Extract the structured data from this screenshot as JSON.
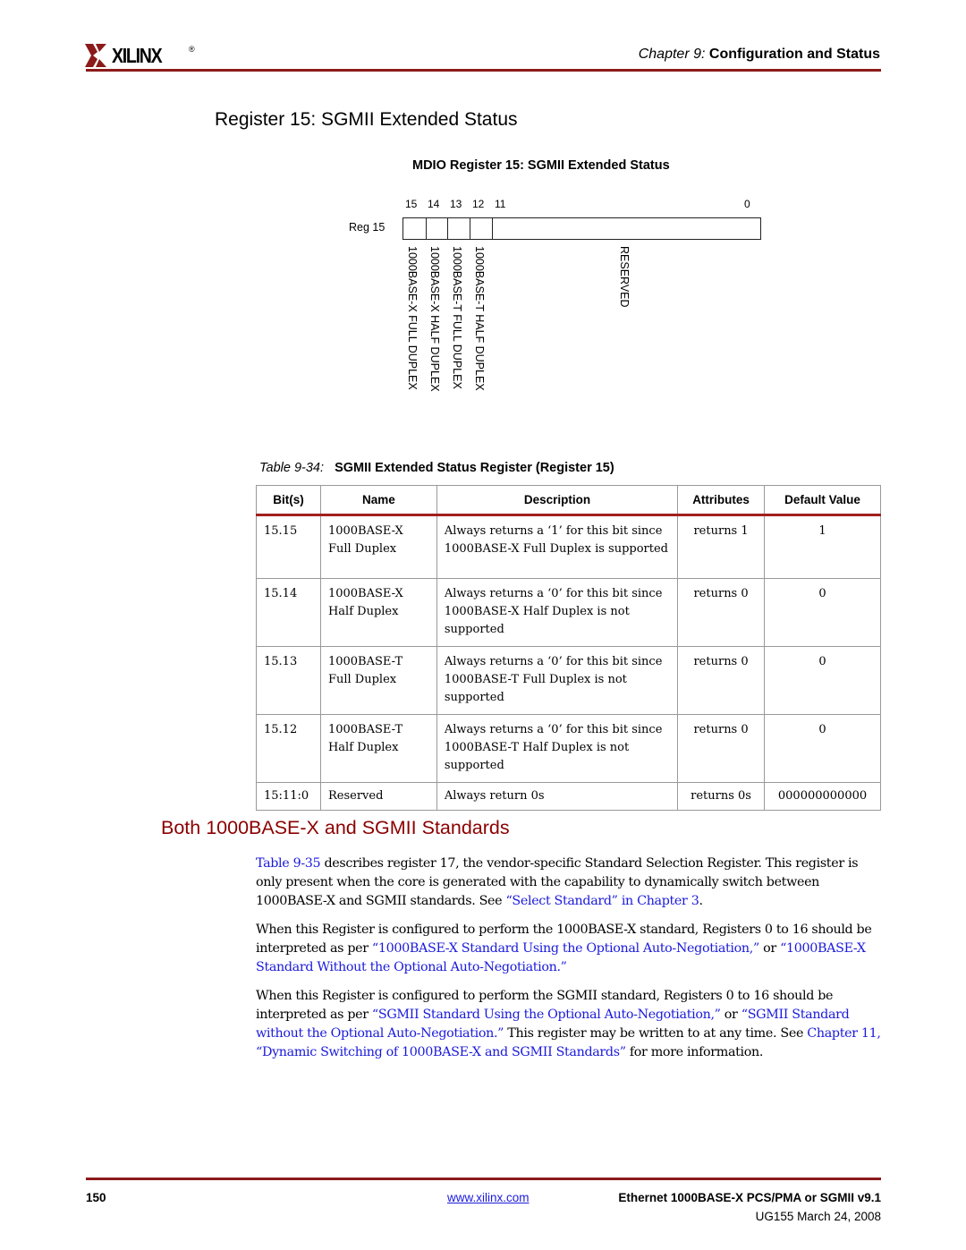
{
  "header": {
    "logo_text": "XILINX",
    "logo_mark": "®",
    "chapter_label": "Chapter 9:",
    "chapter_title": "Configuration and Status"
  },
  "register_section": {
    "heading": "Register 15: SGMII Extended Status",
    "figure_title": "MDIO Register 15: SGMII Extended Status",
    "register_label": "Reg 15",
    "bit_numbers": [
      "15",
      "14",
      "13",
      "12",
      "11",
      "0"
    ],
    "field_labels": [
      "1000BASE-X FULL DUPLEX",
      "1000BASE-X HALF DUPLEX",
      "1000BASE-T FULL DUPLEX",
      "1000BASE-T HALF DUPLEX",
      "RESERVED"
    ]
  },
  "table": {
    "caption_number": "Table 9-34:",
    "caption_title": "SGMII Extended Status Register (Register 15)",
    "columns": [
      "Bit(s)",
      "Name",
      "Description",
      "Attributes",
      "Default Value"
    ],
    "rows": [
      {
        "bits": "15.15",
        "name": "1000BASE-X Full Duplex",
        "description": "Always returns a ‘1’ for this bit since 1000BASE-X Full Duplex is supported",
        "attributes": "returns 1",
        "default": "1"
      },
      {
        "bits": "15.14",
        "name": "1000BASE-X Half Duplex",
        "description": "Always returns a ‘0’ for this bit since 1000BASE-X Half Duplex is not supported",
        "attributes": "returns 0",
        "default": "0"
      },
      {
        "bits": "15.13",
        "name": "1000BASE-T Full Duplex",
        "description": "Always returns a ‘0’ for this bit since 1000BASE-T Full Duplex is not supported",
        "attributes": "returns 0",
        "default": "0"
      },
      {
        "bits": "15.12",
        "name": "1000BASE-T Half Duplex",
        "description": "Always returns a ‘0’ for this bit since 1000BASE-T Half Duplex is not supported",
        "attributes": "returns 0",
        "default": "0"
      },
      {
        "bits": "15:11:0",
        "name": "Reserved",
        "description": "Always return 0s",
        "attributes": "returns 0s",
        "default": "000000000000"
      }
    ]
  },
  "standards_section": {
    "heading": "Both 1000BASE-X and SGMII Standards",
    "p1": {
      "link1": "Table 9-35",
      "text1": " describes register 17, the vendor-specific Standard Selection Register. This register is only present when the core is generated with the capability to dynamically switch between 1000BASE-X and SGMII standards. See ",
      "link2": "“Select Standard” in Chapter 3",
      "text2": "."
    },
    "p2": {
      "text1": "When this Register is configured to perform the 1000BASE-X standard, Registers 0 to 16 should be interpreted as per ",
      "link1": "“1000BASE-X Standard Using the Optional Auto-Negotiation,”",
      "text2": " or ",
      "link2": "“1000BASE-X Standard Without the Optional Auto-Negotiation.”"
    },
    "p3": {
      "text1": "When this Register is configured to perform the SGMII standard, Registers 0 to 16 should be interpreted as per ",
      "link1": "“SGMII Standard Using the Optional Auto-Negotiation,”",
      "text2": " or ",
      "link2": "“SGMII Standard without the Optional Auto-Negotiation.”",
      "text3": " This register may be written to at any time. See ",
      "link3": "Chapter 11, “Dynamic Switching of 1000BASE-X and SGMII Standards”",
      "text4": " for more information."
    }
  },
  "footer": {
    "page_number": "150",
    "website": "www.xilinx.com",
    "doc_title": "Ethernet 1000BASE-X PCS/PMA or SGMII v9.1",
    "doc_id": "UG155 March 24, 2008"
  },
  "colors": {
    "brand_red": "#8b1a1a",
    "heading_red": "#8b0000",
    "link_blue": "#1a1adc"
  }
}
